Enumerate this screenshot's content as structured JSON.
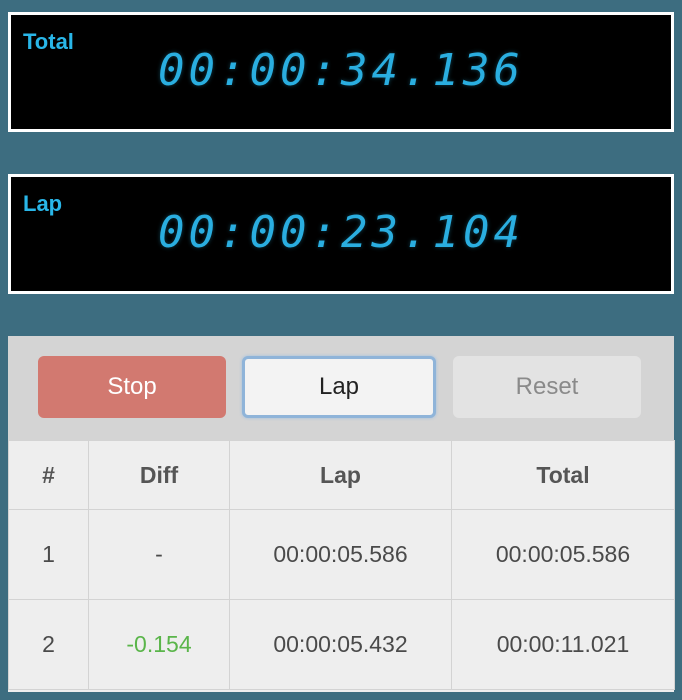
{
  "total_display": {
    "label": "Total",
    "time": "00:00:34.136"
  },
  "lap_display": {
    "label": "Lap",
    "time": "00:00:23.104"
  },
  "toolbar": {
    "stop_label": "Stop",
    "lap_label": "Lap",
    "reset_label": "Reset"
  },
  "table": {
    "headers": [
      "#",
      "Diff",
      "Lap",
      "Total"
    ],
    "rows": [
      {
        "num": "1",
        "diff": "-",
        "lap": "00:00:05.586",
        "total": "00:00:05.586"
      },
      {
        "num": "2",
        "diff": "-0.154",
        "lap": "00:00:05.432",
        "total": "00:00:11.021"
      }
    ]
  },
  "colors": {
    "background": "#3d6d80",
    "display_text": "#29b6e8",
    "stop_button": "#d27970",
    "diff_negative": "#5ab54a"
  }
}
